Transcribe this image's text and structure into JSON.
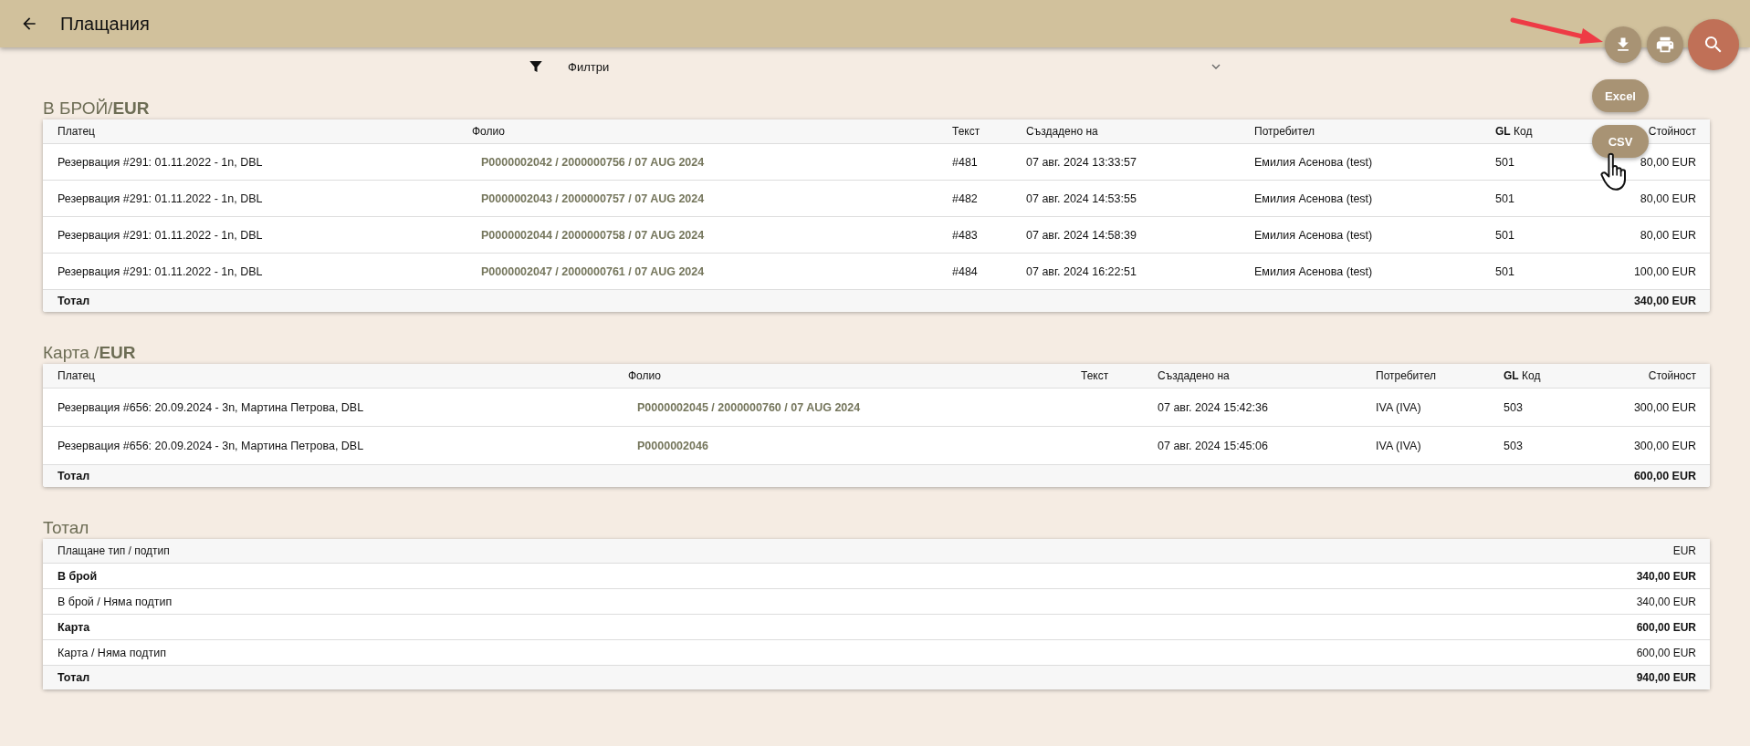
{
  "app_bar": {
    "title": "Плащания"
  },
  "filter": {
    "label": "Филтри"
  },
  "export_menu": [
    {
      "label": "Excel"
    },
    {
      "label": "CSV"
    }
  ],
  "sections": [
    {
      "title": "В БРОЙ/**EUR**",
      "columns": [
        "Платец",
        "Фолио",
        "Текст",
        "Създадено на",
        "Потребител",
        "**GL** Код",
        "Стойност"
      ],
      "rows": [
        {
          "cells": [
            "Резервация #291: 01.11.2022 - 1n, DBL",
            "P0000002042 / 2000000756 / 07 AUG 2024",
            "#481",
            "07 авг. 2024 13:33:57",
            "Емилия Асенова (test)",
            "501",
            "80,00 EUR"
          ]
        },
        {
          "cells": [
            "Резервация #291: 01.11.2022 - 1n, DBL",
            "P0000002043 / 2000000757 / 07 AUG 2024",
            "#482",
            "07 авг. 2024 14:53:55",
            "Емилия Асенова (test)",
            "501",
            "80,00 EUR"
          ]
        },
        {
          "cells": [
            "Резервация #291: 01.11.2022 - 1n, DBL",
            "P0000002044 / 2000000758 / 07 AUG 2024",
            "#483",
            "07 авг. 2024 14:58:39",
            "Емилия Асенова (test)",
            "501",
            "80,00 EUR"
          ]
        },
        {
          "cells": [
            "Резервация #291: 01.11.2022 - 1n, DBL",
            "P0000002047 / 2000000761 / 07 AUG 2024",
            "#484",
            "07 авг. 2024 16:22:51",
            "Емилия Асенова (test)",
            "501",
            "100,00 EUR"
          ]
        }
      ],
      "total": {
        "label": "Тотал",
        "value": "340,00 EUR"
      }
    },
    {
      "title": "Карта /**EUR**",
      "columns": [
        "Платец",
        "Фолио",
        "Текст",
        "Създадено на",
        "Потребител",
        "**GL** Код",
        "Стойност"
      ],
      "rows": [
        {
          "cells": [
            "Резервация #656: 20.09.2024 - 3n, Мартина Петрова, DBL",
            "P0000002045 / 2000000760 / 07 AUG 2024",
            "",
            "07 авг. 2024 15:42:36",
            "IVA (IVA)",
            "503",
            "300,00 EUR"
          ]
        },
        {
          "cells": [
            "Резервация #656: 20.09.2024 - 3n, Мартина Петрова, DBL",
            "P0000002046",
            "",
            "07 авг. 2024 15:45:06",
            "IVA (IVA)",
            "503",
            "300,00 EUR"
          ]
        }
      ],
      "total": {
        "label": "Тотал",
        "value": "600,00 EUR"
      }
    }
  ],
  "summary": {
    "title": "Тотал",
    "columns": [
      "Плащане тип / подтип",
      "EUR"
    ],
    "rows": [
      {
        "kind": "group",
        "label": "В брой",
        "value": "340,00 EUR"
      },
      {
        "kind": "subtype",
        "label": "В брой / Няма подтип",
        "value": "340,00 EUR"
      },
      {
        "kind": "group",
        "label": "Карта",
        "value": "600,00 EUR"
      },
      {
        "kind": "subtype",
        "label": "Карта / Няма подтип",
        "value": "600,00 EUR"
      }
    ],
    "total": {
      "label": "Тотал",
      "value": "940,00 EUR"
    }
  }
}
